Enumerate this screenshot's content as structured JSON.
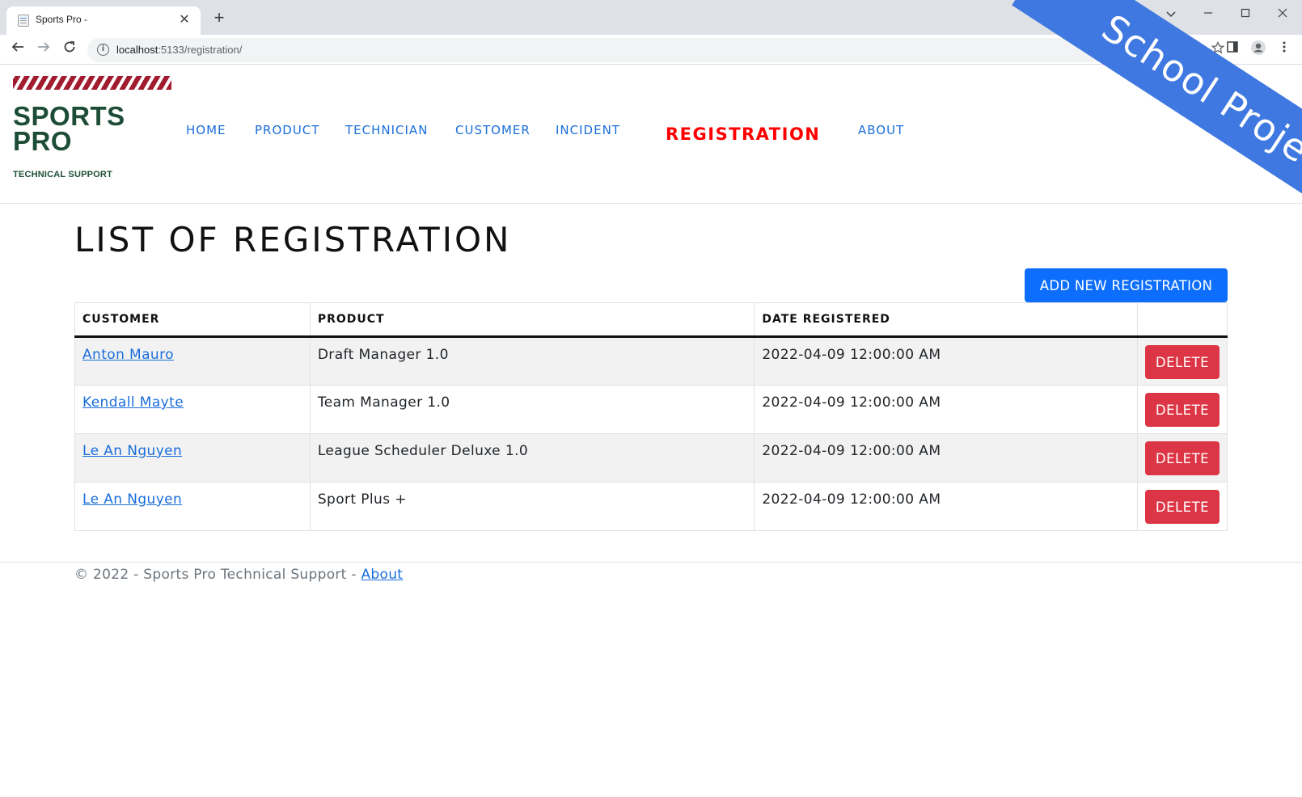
{
  "browser": {
    "tab_title": "Sports Pro -",
    "tab_close": "✕",
    "new_tab": "+",
    "url_host": "localhost",
    "url_rest": ":5133/registration/",
    "window_controls": {
      "minimize": "—",
      "maximize": "☐",
      "close": "✕",
      "dropdown": "⌄"
    }
  },
  "logo": {
    "line1": "SPORTS",
    "line2": "PRO",
    "subtitle": "TECHNICAL SUPPORT"
  },
  "nav": {
    "items": [
      {
        "label": "HOME"
      },
      {
        "label": "PRODUCT"
      },
      {
        "label": "TECHNICIAN"
      },
      {
        "label": "CUSTOMER"
      },
      {
        "label": "INCIDENT"
      },
      {
        "label": "REGISTRATION",
        "active": true
      },
      {
        "label": "ABOUT"
      }
    ]
  },
  "ribbon": {
    "text": "School Project"
  },
  "main": {
    "title": "LIST OF REGISTRATION",
    "add_button": "ADD NEW REGISTRATION",
    "table": {
      "headers": [
        "CUSTOMER",
        "PRODUCT",
        "DATE REGISTERED",
        ""
      ],
      "rows": [
        {
          "customer": "Anton Mauro",
          "product": "Draft Manager 1.0",
          "date": "2022-04-09 12:00:00 AM",
          "action": "DELETE"
        },
        {
          "customer": "Kendall Mayte",
          "product": "Team Manager 1.0",
          "date": "2022-04-09 12:00:00 AM",
          "action": "DELETE"
        },
        {
          "customer": "Le An Nguyen",
          "product": "League Scheduler Deluxe 1.0",
          "date": "2022-04-09 12:00:00 AM",
          "action": "DELETE"
        },
        {
          "customer": "Le An Nguyen",
          "product": "Sport Plus +",
          "date": "2022-04-09 12:00:00 AM",
          "action": "DELETE"
        }
      ]
    }
  },
  "footer": {
    "text": "© 2022 - Sports Pro Technical Support - ",
    "link": "About"
  },
  "colors": {
    "accent": "#0d6efd",
    "nav_link": "#1a6edb",
    "active_nav": "#ff0000",
    "danger": "#dc3545",
    "logo_green": "#1d4d36",
    "logo_red": "#a01c2e",
    "ribbon": "#3f78e0"
  }
}
